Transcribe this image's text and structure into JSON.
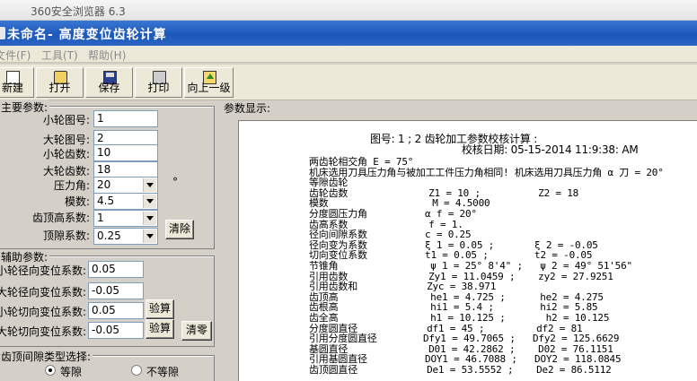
{
  "browser": {
    "title": "360安全浏览器 6.3"
  },
  "window": {
    "title": "未命名- 高度变位齿轮计算"
  },
  "menu": [
    "文件(F)",
    "工具(T)",
    "帮助(H)"
  ],
  "toolbar": [
    {
      "label": "新建",
      "icon": "new-file-icon"
    },
    {
      "label": "打开",
      "icon": "open-folder-icon"
    },
    {
      "label": "保存",
      "icon": "save-disk-icon"
    },
    {
      "label": "打印",
      "icon": "printer-icon"
    },
    {
      "label": "向上一级",
      "icon": "up-folder-icon"
    }
  ],
  "main_params": {
    "title": "主要参数:",
    "small_gear_no": {
      "label": "小轮图号:",
      "value": "1"
    },
    "large_gear_no": {
      "label": "大轮图号:",
      "value": "2"
    },
    "small_teeth": {
      "label": "小轮齿数:",
      "value": "10"
    },
    "large_teeth": {
      "label": "大轮齿数:",
      "value": "18"
    },
    "pressure_angle": {
      "label": "压力角:",
      "value": "20",
      "unit": "°"
    },
    "module": {
      "label": "模数:",
      "value": "4.5"
    },
    "addendum_coef": {
      "label": "齿顶高系数:",
      "value": "1"
    },
    "clearance_coef": {
      "label": "顶隙系数:",
      "value": "0.25"
    },
    "clear_button": "清除"
  },
  "aux_params": {
    "title": "辅助参数:",
    "small_radial": {
      "label": "小轮径向变位系数:",
      "value": "0.05"
    },
    "large_radial": {
      "label": "大轮径向变位系数:",
      "value": "-0.05"
    },
    "small_tangential": {
      "label": "小轮切向变位系数:",
      "value": "0.05"
    },
    "large_tangential": {
      "label": "大轮切向变位系数:",
      "value": "-0.05"
    },
    "verify1": "验算",
    "verify2": "验算",
    "zero_button": "清零"
  },
  "gap_type": {
    "title": "齿顶间隙类型选择:",
    "equal": "等隙",
    "unequal": "不等隙"
  },
  "display": {
    "label": "参数显示:",
    "header1": "图号: 1 ; 2 齿轮加工参数校核计算 :",
    "header2": "校核日期: 05-15-2014 11:9:38: AM",
    "lines": [
      "两齿轮相交角 E = 75°",
      "机床选用刀具压力角与被加工工件压力角相同! 机床选用刀具压力角 α 刀 = 20°",
      "等隙齿轮",
      "齿轮齿数              Z1 = 10 ;          Z2 = 18",
      "模数                  M = 4.5000",
      "分度圆压力角          α f = 20°",
      "齿高系数              f = 1.",
      "径向间隙系数          c = 0.25",
      "径向变为系数          ξ 1 = 0.05 ;       ξ 2 = -0.05",
      "切向变位系数          t1 = 0.05 ;        t2 = -0.05",
      "节锥角                ψ 1 = 25° 8'4\" ;   ψ 2 = 49° 51'56\"",
      "引用齿数              Zy1 = 11.0459 ;    zy2 = 27.9251",
      "引用齿数和            Zyc = 38.971",
      "齿顶高                he1 = 4.725 ;      he2 = 4.275",
      "齿根高                hi1 = 5.4 ;        hi2 = 5.85",
      "齿全高                h1 = 10.125 ;       h2 = 10.125",
      "分度圆直径            df1 = 45 ;         df2 = 81",
      "引用分度圆直径        Dfy1 = 49.7065 ;   Dfy2 = 125.6629",
      "基圆直径              D01 = 42.2862 ;    D02 = 76.1151",
      "引用基圆直径          DOY1 = 46.7088 ;   DOY2 = 118.0845",
      "齿顶圆直径            De1 = 53.5552 ;    De2 = 86.5112"
    ]
  }
}
